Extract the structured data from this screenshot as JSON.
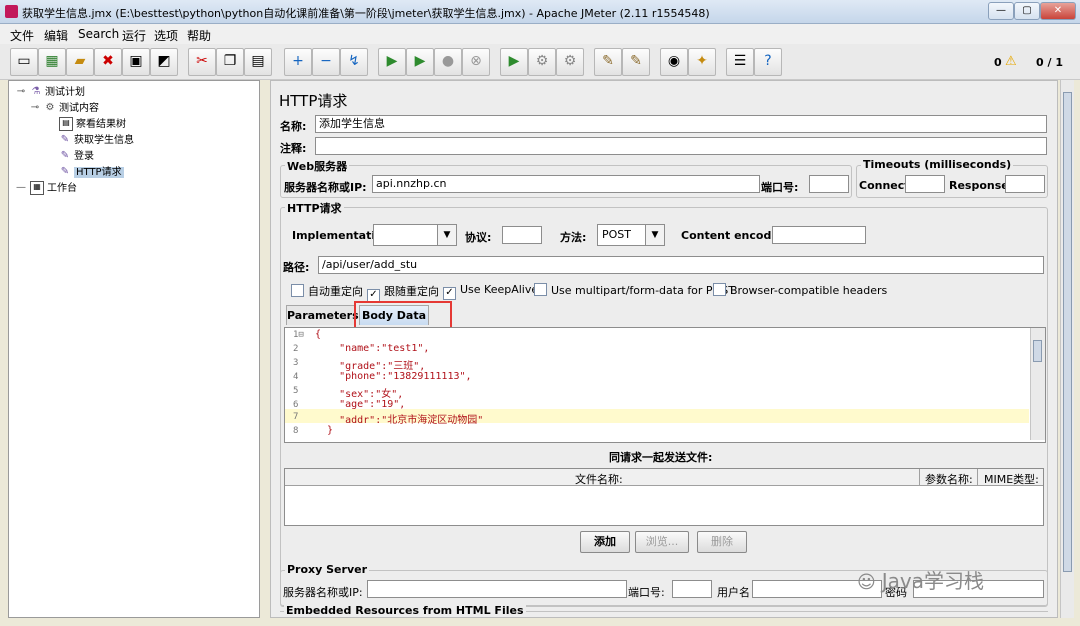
{
  "window": {
    "title": "获取学生信息.jmx (E:\\besttest\\python\\python自动化课前准备\\第一阶段\\jmeter\\获取学生信息.jmx) - Apache JMeter (2.11 r1554548)",
    "minimize": "—",
    "maximize": "▢",
    "close": "✕"
  },
  "menu": [
    "文件",
    "编辑",
    "Search",
    "运行",
    "选项",
    "帮助"
  ],
  "status": {
    "warnings": "0",
    "threads": "0 / 1"
  },
  "tree": [
    {
      "label": "测试计划",
      "icon": "test-plan-icon"
    },
    {
      "label": "测试内容",
      "icon": "thread-group-icon"
    },
    {
      "label": "察看结果树",
      "icon": "result-tree-icon"
    },
    {
      "label": "获取学生信息",
      "icon": "sampler-icon"
    },
    {
      "label": "登录",
      "icon": "sampler-icon"
    },
    {
      "label": "HTTP请求",
      "icon": "sampler-icon"
    },
    {
      "label": "工作台",
      "icon": "workbench-icon"
    }
  ],
  "form": {
    "heading": "HTTP请求",
    "name_label": "名称:",
    "name_value": "添加学生信息",
    "comment_label": "注释:",
    "web_server": {
      "title": "Web服务器",
      "server_label": "服务器名称或IP:",
      "server_value": "api.nnzhp.cn",
      "port_label": "端口号:"
    },
    "timeouts": {
      "title": "Timeouts (milliseconds)",
      "connect": "Connect:",
      "response": "Response:"
    },
    "http_request": {
      "title": "HTTP请求",
      "implementation_label": "Implementation:",
      "protocol_label": "协议:",
      "method_label": "方法:",
      "method_value": "POST",
      "encoding_label": "Content encoding:",
      "path_label": "路径:",
      "path_value": "/api/user/add_stu"
    },
    "checkboxes": [
      {
        "label": "自动重定向",
        "checked": false
      },
      {
        "label": "跟随重定向",
        "checked": true
      },
      {
        "label": "Use KeepAlive",
        "checked": true
      },
      {
        "label": "Use multipart/form-data for POST",
        "checked": false
      },
      {
        "label": "Browser-compatible headers",
        "checked": false
      }
    ],
    "tabs": {
      "parameters": "Parameters",
      "body_data": "Body Data"
    },
    "body_lines": [
      "{",
      "    \"name\":\"test1\",",
      "    \"grade\":\"三班\",",
      "    \"phone\":\"13829111113\",",
      "    \"sex\":\"女\",",
      "    \"age\":\"19\",",
      "    \"addr\":\"北京市海淀区动物园\"",
      "  }"
    ],
    "files": {
      "title": "同请求一起发送文件:",
      "col_filename": "文件名称:",
      "col_param": "参数名称:",
      "col_mime": "MIME类型:"
    },
    "buttons": {
      "add": "添加",
      "browse": "浏览...",
      "delete": "删除"
    },
    "proxy": {
      "title": "Proxy Server",
      "server_label": "服务器名称或IP:",
      "port_label": "端口号:",
      "user_label": "用户名",
      "password_label": "密码"
    },
    "embedded": "Embedded Resources from HTML Files"
  },
  "watermark": "Java学习栈",
  "colors": {
    "highlight": "#fffacd",
    "selected": "#b8cfe5",
    "annotation": "#e53935",
    "code": "#b0121a"
  }
}
